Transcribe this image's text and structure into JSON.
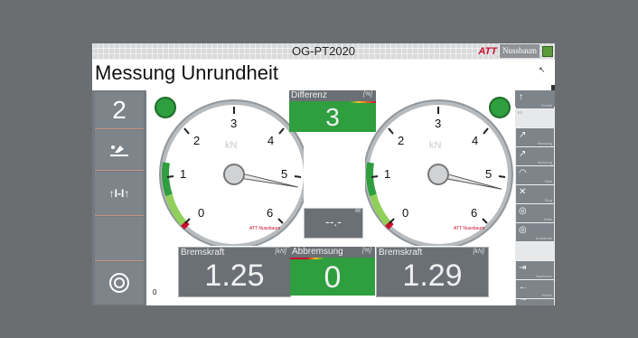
{
  "window": {
    "title": "OG-PT2020"
  },
  "logo": {
    "brand": "ATT",
    "name": "Nussbaum",
    "tagline": "testing technologies"
  },
  "page": {
    "heading": "Messung Unrundheit"
  },
  "left_panel": {
    "axle_number": "2"
  },
  "gauges": [
    {
      "name": "left",
      "unit": "kN",
      "ticks": [
        "0",
        "1",
        "2",
        "3",
        "4",
        "5",
        "6"
      ],
      "value": 1.25,
      "max": 6,
      "logo": "ATT Nussbaum"
    },
    {
      "name": "right",
      "unit": "kN",
      "ticks": [
        "0",
        "1",
        "2",
        "3",
        "4",
        "5",
        "6"
      ],
      "value": 1.29,
      "max": 6,
      "logo": "ATT Nussbaum"
    }
  ],
  "differenz": {
    "label": "Differenz",
    "unit": "[%]",
    "value": "3"
  },
  "middle_display": {
    "value": "--.-"
  },
  "bremskraft_left": {
    "label": "Bremskraft",
    "unit": "[kN]",
    "value": "1.25"
  },
  "abbremsung": {
    "label": "Abbremsung",
    "unit": "[%]",
    "value": "0"
  },
  "bremskraft_right": {
    "label": "Bremskraft",
    "unit": "[kN]",
    "value": "1.29"
  },
  "footer": {
    "value": "0"
  },
  "right_menu": [
    {
      "label": "Zurück",
      "icon": "up-arrow-icon"
    },
    {
      "label": "F2",
      "icon": "blank"
    },
    {
      "label": "Messung",
      "icon": "ref-icon"
    },
    {
      "label": "Messung",
      "icon": "ref-icon"
    },
    {
      "label": "Start",
      "icon": "speed-icon"
    },
    {
      "label": "Stop",
      "icon": "brake-icon"
    },
    {
      "label": "Rolle",
      "icon": "wheel-icon"
    },
    {
      "label": "Aufnahme",
      "icon": "wheel-icon"
    },
    {
      "label": "Speichern",
      "icon": "export-icon"
    },
    {
      "label": "Weiter",
      "icon": "left-arrow-icon"
    },
    {
      "label": "Ende",
      "icon": "right-arrow-icon"
    }
  ],
  "colors": {
    "status_green": "#2f9e3e",
    "panel_gray": "#6a7075",
    "accent_red": "#c8102e"
  }
}
